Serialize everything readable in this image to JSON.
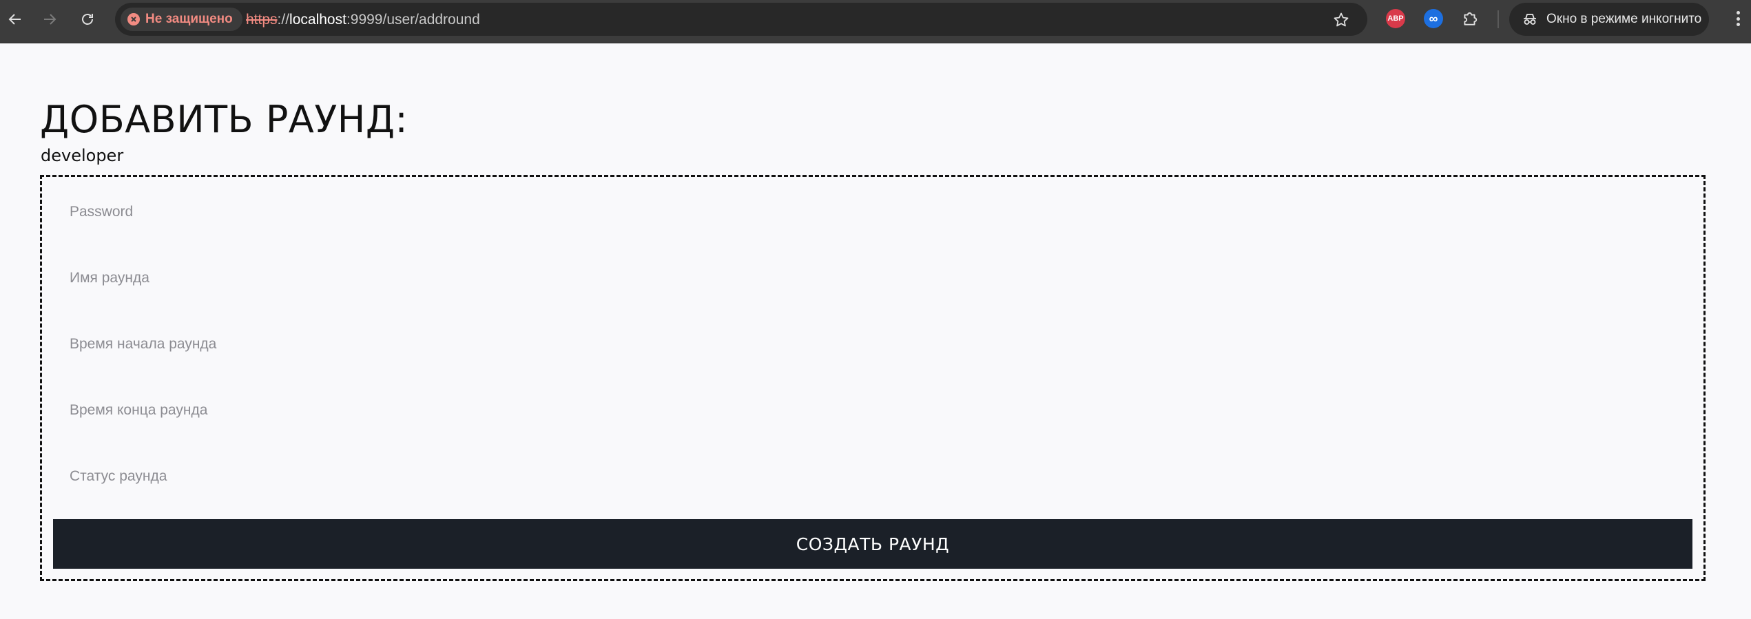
{
  "browser": {
    "security_label": "Не защищено",
    "url_scheme": "https",
    "url_separator": "://",
    "url_host": "localhost",
    "url_rest": ":9999/user/addround",
    "extensions": {
      "abp_label": "ABP",
      "infinity_label": "∞"
    },
    "incognito_label": "Окно в режиме инкогнито"
  },
  "page": {
    "title": "ДОБАВИТЬ РАУНД:",
    "username": "developer"
  },
  "form": {
    "fields": [
      {
        "placeholder": "Password",
        "value": ""
      },
      {
        "placeholder": "Имя раунда",
        "value": ""
      },
      {
        "placeholder": "Время начала раунда",
        "value": ""
      },
      {
        "placeholder": "Время конца раунда",
        "value": ""
      },
      {
        "placeholder": "Статус раунда",
        "value": ""
      }
    ],
    "submit_label": "СОЗДАТЬ РАУНД"
  },
  "colors": {
    "page_background": "#f9f9fb",
    "button_background": "#1b2028",
    "insecure_red": "#f28b82"
  }
}
